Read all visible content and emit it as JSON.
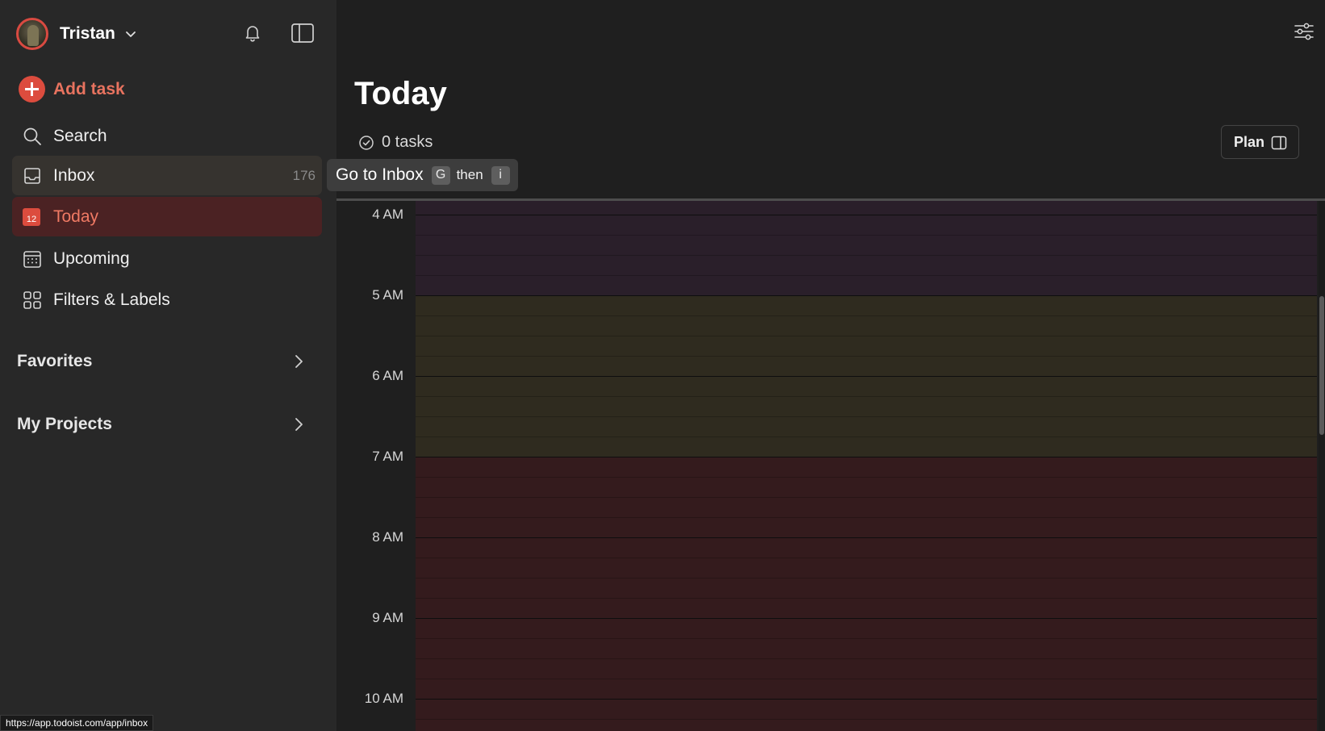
{
  "user": {
    "name": "Tristan"
  },
  "sidebar": {
    "add_task": "Add task",
    "items": [
      {
        "label": "Search"
      },
      {
        "label": "Inbox",
        "count": "176"
      },
      {
        "label": "Today",
        "icon_text": "12"
      },
      {
        "label": "Upcoming"
      },
      {
        "label": "Filters & Labels"
      }
    ],
    "sections": [
      {
        "label": "Favorites"
      },
      {
        "label": "My Projects"
      }
    ]
  },
  "main": {
    "title": "Today",
    "task_count": "0 tasks",
    "plan_button": "Plan"
  },
  "timeline": {
    "hours": [
      "4 AM",
      "5 AM",
      "6 AM",
      "7 AM",
      "8 AM",
      "9 AM",
      "10 AM"
    ],
    "band_colors": {
      "early": "#2a1f2a",
      "morning": "#2f2b1f",
      "day": "#341b1d"
    }
  },
  "tooltip": {
    "text": "Go to Inbox",
    "key1": "G",
    "then": "then",
    "key2": "i"
  },
  "status_bar": {
    "url": "https://app.todoist.com/app/inbox"
  },
  "colors": {
    "accent": "#dc4c3e",
    "sidebar_bg": "#282828",
    "main_bg": "#1f1f1f"
  }
}
